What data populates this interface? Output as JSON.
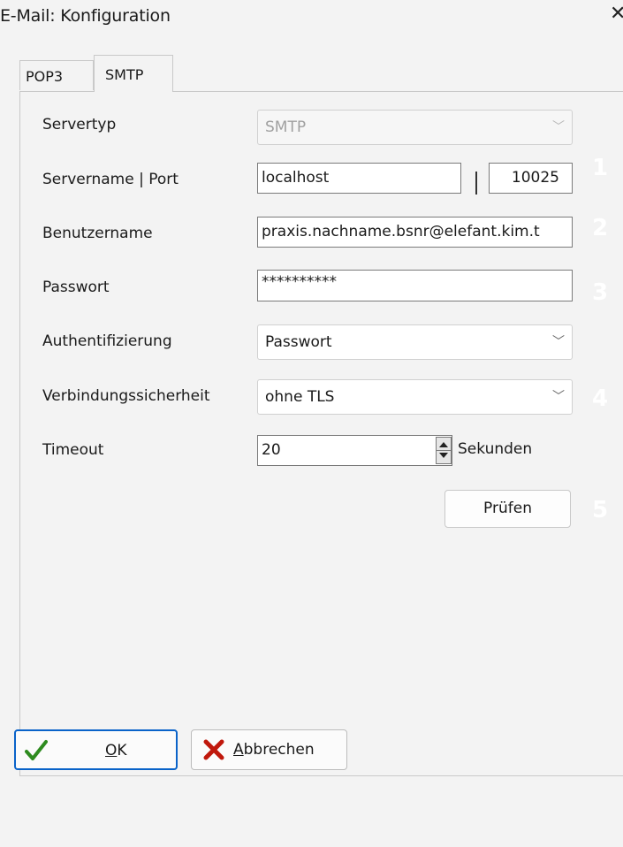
{
  "window": {
    "title": "E-Mail: Konfiguration",
    "close_glyph": "✕"
  },
  "tabs": [
    {
      "label": "POP3",
      "active": false
    },
    {
      "label": "SMTP",
      "active": true
    }
  ],
  "form": {
    "servertyp": {
      "label": "Servertyp",
      "value": "SMTP",
      "disabled": true
    },
    "servername": {
      "label": "Servername | Port",
      "host": "localhost",
      "separator": "|",
      "port": "10025"
    },
    "benutzername": {
      "label": "Benutzername",
      "value": "praxis.nachname.bsnr@elefant.kim.t"
    },
    "passwort": {
      "label": "Passwort",
      "value": "**********"
    },
    "authentifizierung": {
      "label": "Authentifizierung",
      "value": "Passwort"
    },
    "verbindungssicherheit": {
      "label": "Verbindungssicherheit",
      "value": "ohne TLS"
    },
    "timeout": {
      "label": "Timeout",
      "value": "20",
      "unit": "Sekunden"
    },
    "pruefen_label": "Prüfen"
  },
  "markers": [
    "1",
    "2",
    "3",
    "4",
    "5"
  ],
  "footer": {
    "ok_mnemonic": "O",
    "ok_rest": "K",
    "cancel_mnemonic": "A",
    "cancel_rest": "bbrechen"
  },
  "icons": {
    "ok": "checkmark-icon",
    "cancel": "cross-icon",
    "dropdown": "chevron-down-icon"
  },
  "colors": {
    "ok_check": "#2e8b1f",
    "cancel_x": "#c0180c",
    "ok_border": "#0a63c9"
  }
}
